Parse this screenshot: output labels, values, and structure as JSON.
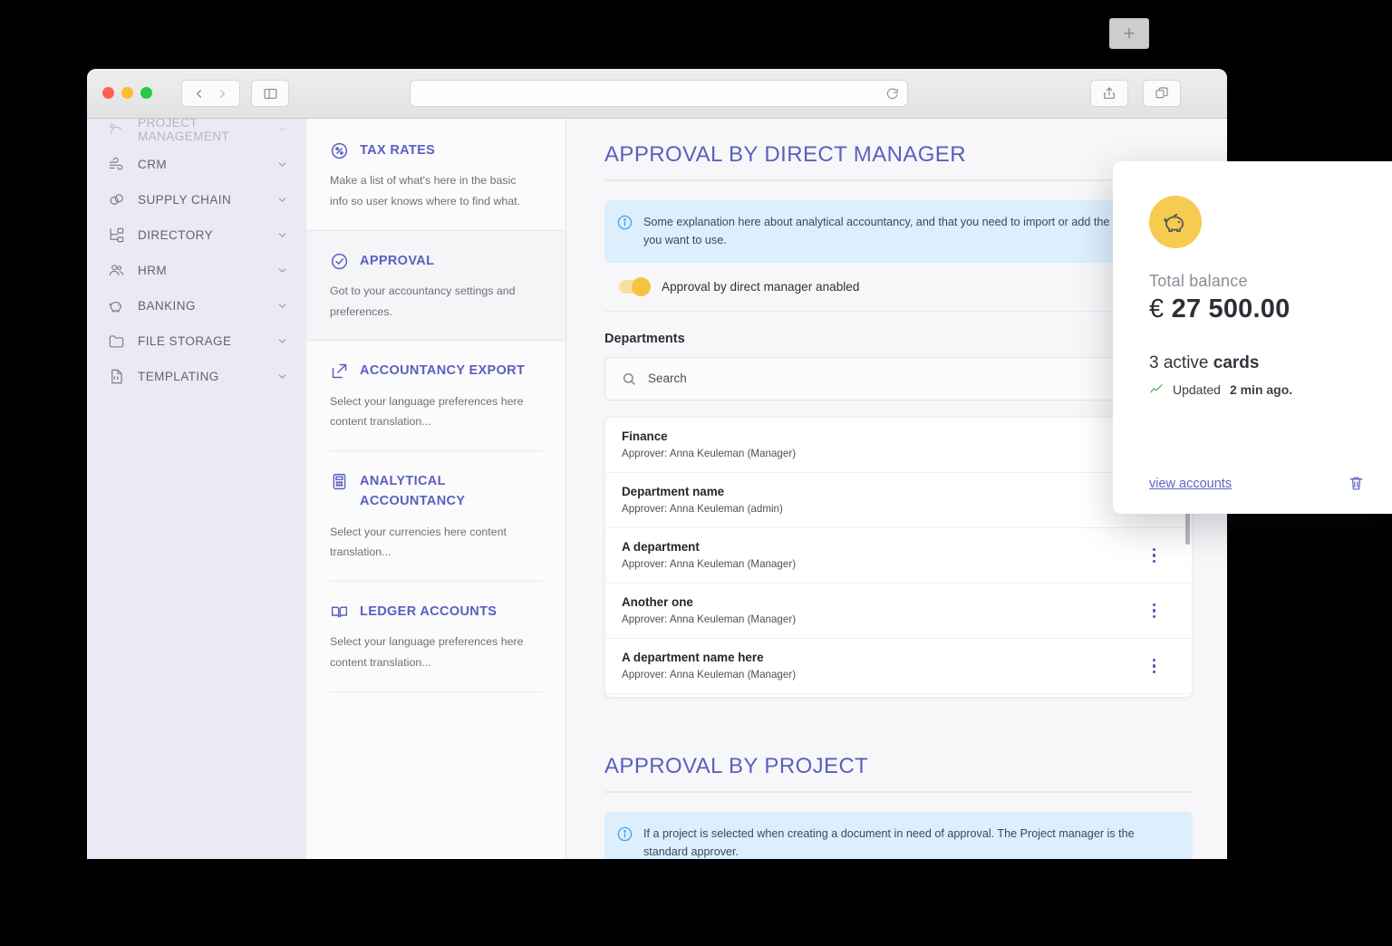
{
  "browser": {
    "back_label": "‹",
    "forward_label": "›",
    "sidebar_toggle_name": "sidebar-toggle-icon",
    "url_value": "",
    "url_placeholder": "",
    "reload_label": "reload-icon",
    "share_label": "share-icon",
    "tabs_label": "tab-overview-icon",
    "new_tab_label": "+"
  },
  "sidebar": {
    "items": [
      {
        "label": "PROJECT MANAGEMENT",
        "icon": "project-management-icon",
        "clipped": true
      },
      {
        "label": "CRM",
        "icon": "crm-icon",
        "clipped": false
      },
      {
        "label": "SUPPLY CHAIN",
        "icon": "supply-chain-icon",
        "clipped": false
      },
      {
        "label": "DIRECTORY",
        "icon": "directory-icon",
        "clipped": false
      },
      {
        "label": "HRM",
        "icon": "hrm-icon",
        "clipped": false
      },
      {
        "label": "BANKING",
        "icon": "banking-icon",
        "clipped": false
      },
      {
        "label": "FILE STORAGE",
        "icon": "folder-icon",
        "clipped": false
      },
      {
        "label": "TEMPLATING",
        "icon": "templating-icon",
        "clipped": false
      }
    ]
  },
  "submenu": {
    "items": [
      {
        "title": "TAX RATES",
        "icon": "percent-icon",
        "desc": "Make a list of what's here in the basic info so user knows where to find what.",
        "active": false
      },
      {
        "title": "APPROVAL",
        "icon": "check-circle-icon",
        "desc": "Got to your accountancy settings and preferences.",
        "active": true
      },
      {
        "title": "ACCOUNTANCY EXPORT",
        "icon": "external-link-icon",
        "desc": "Select your language preferences here content translation...",
        "active": false
      },
      {
        "title": "ANALYTICAL ACCOUNTANCY",
        "icon": "calculator-icon",
        "desc": "Select your currencies here content translation...",
        "active": false
      },
      {
        "title": "LEDGER ACCOUNTS",
        "icon": "book-icon",
        "desc": "Select your language preferences here content translation...",
        "active": false
      }
    ]
  },
  "main": {
    "section1": {
      "title": "APPROVAL BY DIRECT MANAGER",
      "info": "Some explanation here about analytical accountancy, and that you need to import or add the cost assets you want to use.",
      "toggle_label": "Approval by direct manager anabled",
      "toggle_state": "on",
      "departments_heading": "Departments",
      "search_placeholder": "Search",
      "search_value": "",
      "departments": [
        {
          "name": "Finance",
          "approver": "Approver: Anna Keuleman (Manager)"
        },
        {
          "name": "Department name",
          "approver": "Approver: Anna Keuleman (admin)"
        },
        {
          "name": "A department",
          "approver": "Approver: Anna Keuleman (Manager)"
        },
        {
          "name": "Another one",
          "approver": "Approver: Anna Keuleman (Manager)"
        },
        {
          "name": "A department name here",
          "approver": "Approver: Anna Keuleman (Manager)"
        }
      ]
    },
    "section2": {
      "title": "APPROVAL BY PROJECT",
      "info": "If a project is selected when creating a document in need of approval. The Project manager is the standard approver."
    }
  },
  "balance_card": {
    "icon": "piggy-bank-icon",
    "label": "Total balance",
    "currency": "€",
    "amount": "27 500.00",
    "amount_full": "€ 27 500.00",
    "cards_count": "3 active",
    "cards_word": "cards",
    "updated_prefix": "Updated",
    "updated_value": "2 min ago.",
    "view_accounts": "view accounts",
    "delete_icon": "trash-icon"
  },
  "colors": {
    "accent_purple": "#5a5fc0",
    "toggle_yellow": "#f5c43f",
    "info_blue_bg": "#ddeefc",
    "info_blue_icon": "#48a0e8",
    "sidebar_bg": "#eaeaf5",
    "piggy_yellow": "#f5cb50",
    "trend_green": "#4fb96b"
  }
}
